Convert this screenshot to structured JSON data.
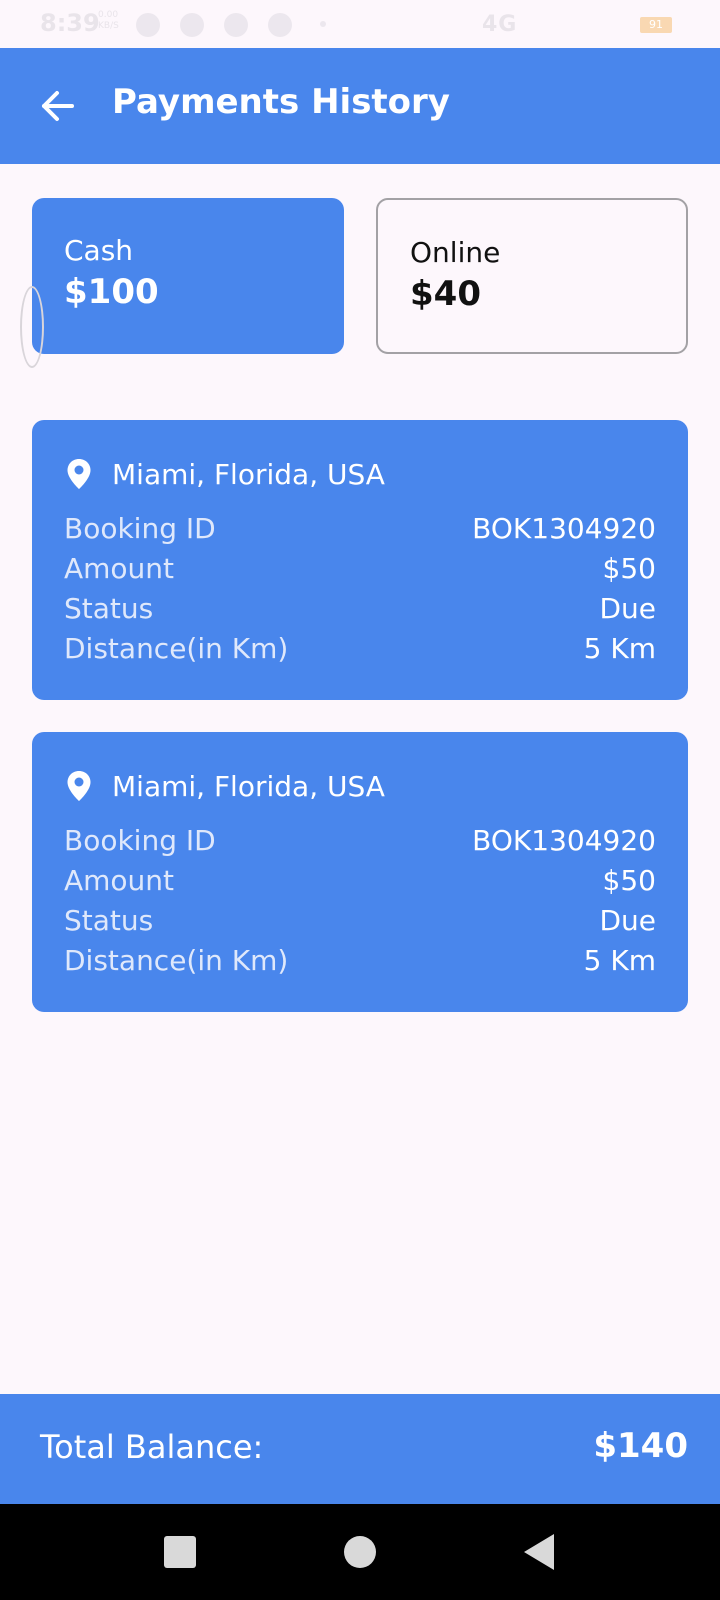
{
  "status_bar": {
    "time": "8:39",
    "small_text": "0.00 KB/S",
    "network": "4G",
    "battery": "91"
  },
  "app_bar": {
    "title": "Payments History",
    "back_icon": "arrow-left-icon"
  },
  "summary": {
    "cash": {
      "label": "Cash",
      "amount": "$100"
    },
    "online": {
      "label": "Online",
      "amount": "$40"
    }
  },
  "payments": [
    {
      "location": "Miami, Florida, USA",
      "icon": "map-pin-icon",
      "rows": [
        {
          "key": "Booking ID",
          "value": "BOK1304920"
        },
        {
          "key": "Amount",
          "value": "$50"
        },
        {
          "key": "Status",
          "value": "Due"
        },
        {
          "key": "Distance(in Km)",
          "value": "5 Km"
        }
      ]
    },
    {
      "location": "Miami, Florida, USA",
      "icon": "map-pin-icon",
      "rows": [
        {
          "key": "Booking ID",
          "value": "BOK1304920"
        },
        {
          "key": "Amount",
          "value": "$50"
        },
        {
          "key": "Status",
          "value": "Due"
        },
        {
          "key": "Distance(in Km)",
          "value": "5 Km"
        }
      ]
    }
  ],
  "total": {
    "label": "Total Balance:",
    "value": "$140"
  },
  "colors": {
    "primary": "#4986ec",
    "background": "#fdf7fc",
    "outline": "#a3a1a5"
  },
  "nav_bar": {
    "recents_icon": "square-icon",
    "home_icon": "circle-icon",
    "back_icon": "triangle-back-icon"
  }
}
